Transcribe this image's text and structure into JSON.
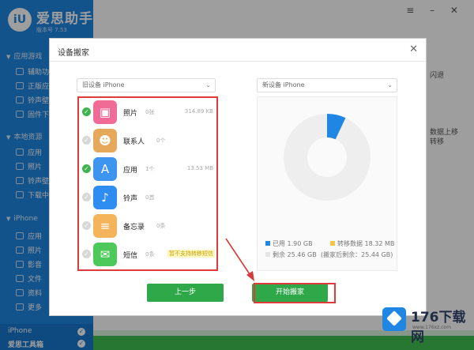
{
  "app": {
    "name": "爱思助手",
    "version": "版本号 7.53",
    "logo_text": "iU",
    "window_controls": "≡ – ✕"
  },
  "sidebar": {
    "groups": [
      {
        "label": "应用游戏",
        "items": [
          "辅助功能",
          "正版应用",
          "铃声壁纸",
          "固件下载"
        ]
      },
      {
        "label": "本地资源",
        "items": [
          "应用",
          "照片",
          "铃声壁纸",
          "下载中心"
        ]
      },
      {
        "label": "iPhone",
        "items": [
          "应用",
          "照片",
          "影音",
          "文件",
          "资料",
          "更多"
        ]
      }
    ],
    "footer": {
      "device": "iPhone",
      "toolbox": "爱思工具箱"
    }
  },
  "background": {
    "frag_right_1": "闪退",
    "frag_right_2": "数据上移",
    "frag_right_3": "转移"
  },
  "dialog": {
    "title": "设备搬家",
    "close": "✕",
    "source_select": "旧设备 iPhone",
    "target_select": "新设备 iPhone",
    "chevron": "⌄",
    "rows": [
      {
        "label": "照片",
        "count": "0张",
        "size": "314.89 KB",
        "checked": true,
        "color": "#f06b95",
        "icon": "photos-icon",
        "glyph": "▣"
      },
      {
        "label": "联系人",
        "count": "0个",
        "size": "",
        "checked": false,
        "color": "#e6a85a",
        "icon": "contacts-icon",
        "glyph": "☻"
      },
      {
        "label": "应用",
        "count": "1个",
        "size": "13.53 MB",
        "checked": true,
        "color": "#3e95f0",
        "icon": "appstore-icon",
        "glyph": "A"
      },
      {
        "label": "铃声",
        "count": "0首",
        "size": "",
        "checked": false,
        "color": "#2f8cf0",
        "icon": "bell-icon",
        "glyph": "♪"
      },
      {
        "label": "备忘录",
        "count": "0条",
        "size": "",
        "checked": false,
        "color": "#f3b45c",
        "icon": "notes-icon",
        "glyph": "≡"
      },
      {
        "label": "短信",
        "count": "0条",
        "size": "",
        "tag": "暂不支持转移短信",
        "checked": false,
        "color": "#4cc95a",
        "icon": "message-icon",
        "glyph": "✉"
      }
    ],
    "storage": {
      "used_fraction": 0.07,
      "used_label": "已用",
      "used_value": "1.90 GB",
      "transfer_label": "转移数据",
      "transfer_value": "18.32 MB",
      "free_label": "剩余",
      "free_value": "25.46 GB",
      "after_label": "(搬家后剩余：25.44 GB)"
    },
    "buttons": {
      "prev": "上一步",
      "start": "开始搬家"
    }
  },
  "watermark": {
    "text": "176下载网",
    "url": "www.176xz.com"
  },
  "colors": {
    "brand": "#1f86e3",
    "green": "#2fa84a",
    "highlight": "#e03a3a",
    "used": "#1f86e3",
    "transfer": "#f2c94c",
    "free": "#eeeeee"
  }
}
